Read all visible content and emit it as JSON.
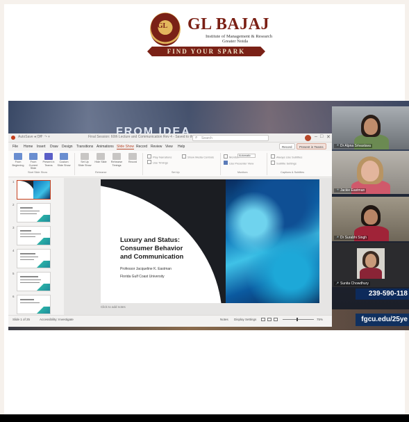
{
  "logo": {
    "emblem_text": "GL",
    "title": "GL BAJAJ",
    "subtitle_line1": "Institute of Management & Research",
    "subtitle_line2": "Greater Noida",
    "tagline": "FIND YOUR SPARK"
  },
  "background": {
    "headline": "FROM IDEA"
  },
  "ppt": {
    "title_text": "Final Session: 60th Lecture and Communication Rev 4 - Saved to this PC",
    "search_placeholder": "Search",
    "menu": [
      "File",
      "Home",
      "Insert",
      "Draw",
      "Design",
      "Transitions",
      "Animations",
      "Slide Show",
      "Record",
      "Review",
      "View",
      "Help"
    ],
    "active_menu": "Slide Show",
    "record_button": "Record",
    "present_button": "Present in Teams",
    "ribbon_buttons": [
      "From Beginning",
      "From Current Slide",
      "Present in Teams",
      "Custom Slide Show",
      "Set Up Slide Show",
      "Hide Slide",
      "Rehearse Timings",
      "Record"
    ],
    "ribbon_groups": [
      "Start Slide Show",
      "Rehearse",
      "Set Up",
      "Monitors",
      "Captions & Subtitles"
    ],
    "setup_checks": [
      "Play Narrations",
      "Use Timings",
      "Show Media Controls"
    ],
    "monitors": {
      "monitor_label": "Monitor:",
      "monitor_value": "Automatic",
      "presenter_view": "Use Presenter View"
    },
    "captions_checks": [
      "Always Use Subtitles",
      "Subtitle Settings"
    ],
    "thumbnail_numbers": [
      "1",
      "2",
      "3",
      "4",
      "5",
      "6"
    ],
    "slide": {
      "title_line1": "Luxury and Status:",
      "title_line2": "Consumer Behavior",
      "title_line3": "and Communication",
      "author": "Professor Jacqueline K. Eastman",
      "university": "Florida Gulf Coast University"
    },
    "notes_placeholder": "Click to add notes",
    "status": {
      "slide_count": "Slide 1 of 25",
      "accessibility": "Accessibility: Investigate",
      "notes": "Notes",
      "display_settings": "Display Settings",
      "zoom": "75%"
    }
  },
  "participants": [
    {
      "name": "Dr Alpna Srivastava"
    },
    {
      "name": "Jackie Eastman"
    },
    {
      "name": "Dr Surabhi Singh"
    },
    {
      "name": "Sunita Chowdhury"
    }
  ],
  "fgcu": {
    "phone": "239-590-118",
    "url": "fgcu.edu/25ye"
  },
  "colors": {
    "brand_maroon": "#7a2116",
    "ppt_accent": "#c43e1c",
    "fgcu_navy": "#0d2a5b"
  }
}
